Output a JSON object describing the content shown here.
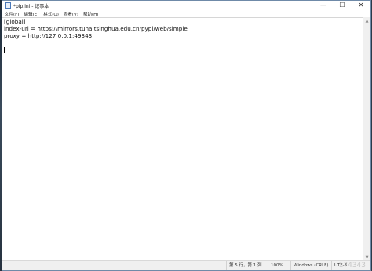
{
  "window": {
    "title": "*pip.ini - 记事本",
    "controls": {
      "minimize": "—",
      "maximize": "☐",
      "close": "✕"
    }
  },
  "menu": [
    "文件(F)",
    "编辑(E)",
    "格式(O)",
    "查看(V)",
    "帮助(H)"
  ],
  "editor": {
    "lines": [
      "[global]",
      "index-url = https://mirrors.tuna.tsinghua.edu.cn/pypi/web/simple",
      "proxy = http://127.0.0.1:49343"
    ]
  },
  "status": {
    "position": "第 5 行，第 1 列",
    "zoom": "100%",
    "line_ending": "Windows (CRLF)",
    "encoding": "UTF-8"
  },
  "watermark": "174343"
}
